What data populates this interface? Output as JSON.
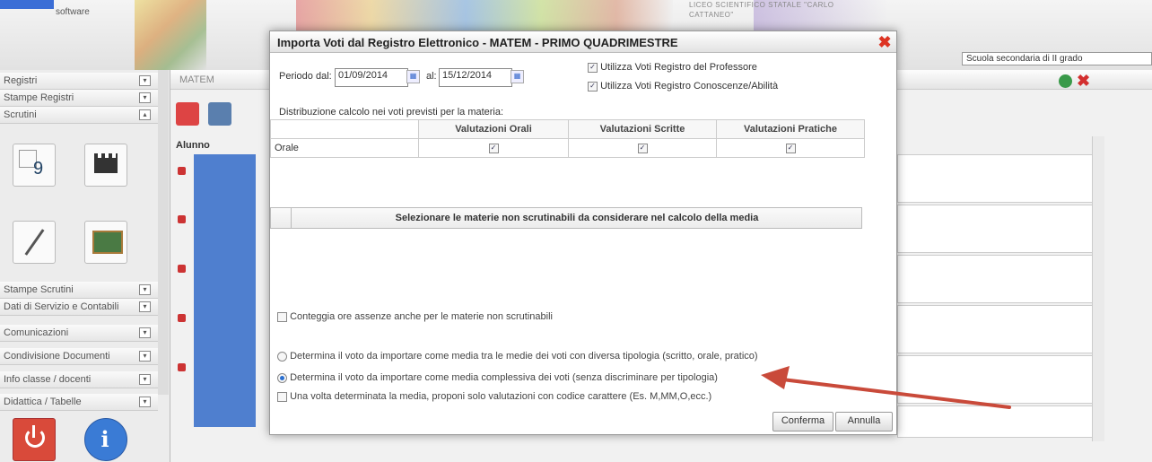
{
  "header": {
    "brand": "software",
    "school": "LICEO SCIENTIFICO STATALE \"CARLO CATTANEO\"",
    "school_level": "Scuola secondaria di II grado"
  },
  "sidebar": {
    "items": [
      {
        "label": "Registri"
      },
      {
        "label": "Stampe Registri"
      },
      {
        "label": "Scrutini"
      },
      {
        "label": "Stampe Scrutini"
      },
      {
        "label": "Dati di Servizio e Contabili"
      },
      {
        "label": "Comunicazioni"
      },
      {
        "label": "Condivisione Documenti"
      },
      {
        "label": "Info classe / docenti"
      },
      {
        "label": "Didattica / Tabelle"
      }
    ]
  },
  "grid": {
    "subject_tab": "MATEM",
    "column_alunno": "Alunno"
  },
  "dialog": {
    "title": "Importa Voti dal Registro Elettronico - MATEM - PRIMO QUADRIMESTRE",
    "period_from_label": "Periodo dal:",
    "period_from": "01/09/2014",
    "period_to_label": "al:",
    "period_to": "15/12/2014",
    "use_teacher_register": "Utilizza Voti Registro del Professore",
    "use_knowledge_register": "Utilizza Voti Registro Conoscenze/Abilità",
    "distribution_label": "Distribuzione calcolo nei voti previsti per la materia:",
    "columns": [
      "Valutazioni Orali",
      "Valutazioni Scritte",
      "Valutazioni Pratiche"
    ],
    "row_label": "Orale",
    "select_subjects": "Selezionare le materie non scrutinabili da considerare nel calcolo della media",
    "count_absences": "Conteggia ore assenze anche per le materie non scrutinabili",
    "option_by_type": "Determina il voto da importare come media tra le medie dei voti con diversa tipologia (scritto, orale, pratico)",
    "option_overall": "Determina il voto da importare come media complessiva dei voti (senza discriminare per tipologia)",
    "option_codes": "Una volta determinata la media, proponi solo valutazioni con codice carattere (Es. M,MM,O,ecc.)",
    "confirm": "Conferma",
    "cancel": "Annulla"
  },
  "colors": {
    "arrow": "#c94a3a",
    "selected_radio": "#2a6fd0",
    "close": "#d32f2f"
  }
}
